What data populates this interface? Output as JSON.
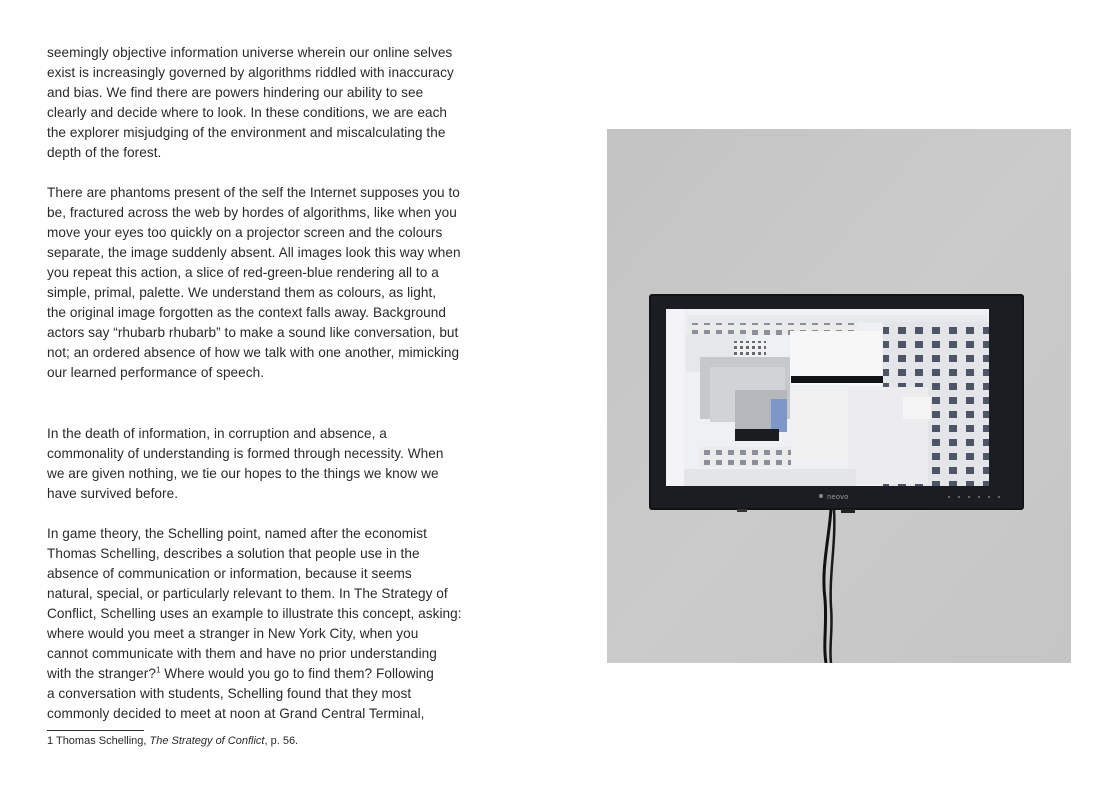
{
  "article": {
    "paragraph_1": "seemingly objective information universe wherein our online selves\nexist is increasingly governed by algorithms riddled with inaccuracy\nand bias. We find there are powers hindering our ability to see\nclearly and decide where to look. In these conditions, we are each\nthe explorer misjudging of the environment and miscalculating the\ndepth of the forest.",
    "paragraph_2": "There are phantoms present of the self the Internet supposes you to\nbe, fractured across the web by hordes of algorithms, like when you\nmove your eyes too quickly on a projector screen and the colours\nseparate, the image suddenly absent. All images look this way when\nyou repeat this action, a slice of red-green-blue rendering all to a\nsimple, primal, palette. We understand them as colours, as light,\nthe original image forgotten as the context falls away. Background\nactors say “rhubarb rhubarb” to make a sound like conversation, but\nnot; an ordered absence of how we talk with one another, mimicking\nour learned performance of speech.",
    "paragraph_3": "In the death of information, in corruption and absence, a\ncommonality of understanding is formed through necessity. When\nwe are given nothing, we tie our hopes to the things we know we\nhave survived before.",
    "paragraph_4_before_ref": "In game theory, the Schelling point, named after the economist\nThomas Schelling, describes a solution that people use in the\nabsence of communication or information, because it seems\nnatural, special, or particularly relevant to them. In The Strategy of\nConflict, Schelling uses an example to illustrate this concept, asking:\nwhere would you meet a stranger in New York City, when you\ncannot communicate with them and have no prior understanding\nwith the stranger?",
    "paragraph_4_ref": "1",
    "paragraph_4_after_ref": " Where would you go to find them? Following\na conversation with students, Schelling found that they most\ncommonly decided to meet at noon at Grand Central Terminal,"
  },
  "footnote": {
    "number_author": "1 Thomas Schelling, ",
    "title": "The Strategy of Conflict",
    "page": ", p. 56."
  },
  "photo": {
    "monitor_brand": "neovo"
  }
}
